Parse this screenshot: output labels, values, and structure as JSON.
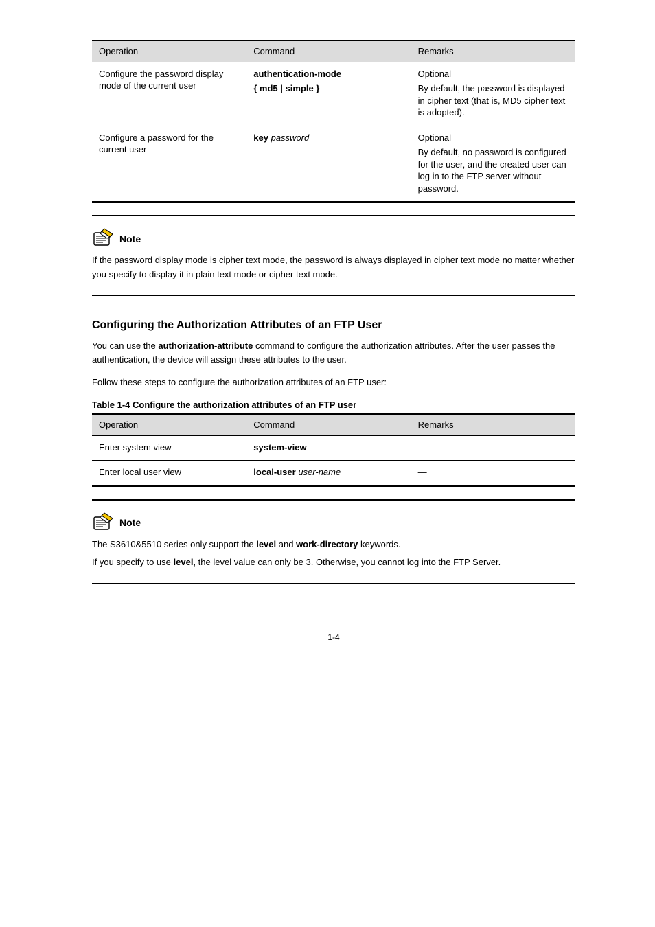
{
  "table1": {
    "headers": [
      "Operation",
      "Command",
      "Remarks"
    ],
    "rows": [
      {
        "op": "Configure the password display mode of the current user",
        "cmd_main": "authentication-mode",
        "cmd_opt": "{ md5 | simple }",
        "rem_title": "Optional",
        "rem_body": "By default, the password is displayed in cipher text (that is, MD5 cipher text is adopted)."
      },
      {
        "op": "Configure a password for the current user",
        "cmd_main": "key",
        "cmd_arg": "password",
        "rem_title": "Optional",
        "rem_body": "By default, no password is configured for the user, and the created user can log in to the FTP server without password."
      }
    ]
  },
  "note1": {
    "label": "Note",
    "body": "If the password display mode is cipher text mode, the password is always displayed in cipher text mode no matter whether you specify to display it in plain text mode or cipher text mode."
  },
  "section_heading": "Configuring the Authorization Attributes of an FTP User",
  "para1": {
    "pre": "You can use the ",
    "cmd": "authorization-attribute",
    "post": " command to configure the authorization attributes. After the user passes the authentication, the device will assign these attributes to the user."
  },
  "para2": "Follow these steps to configure the authorization attributes of an FTP user:",
  "table2_caption": "Table 1-4 Configure the authorization attributes of an FTP user",
  "table2": {
    "headers": [
      "Operation",
      "Command",
      "Remarks"
    ],
    "rows": [
      {
        "op": "Enter system view",
        "cmd": "system-view",
        "rem": "—"
      },
      {
        "op": "Enter local user view",
        "cmd_main": "local-user",
        "cmd_arg": "user-name",
        "rem": "—"
      }
    ]
  },
  "note2": {
    "label": "Note",
    "lines": [
      {
        "pre": "The S3610&5510 series only support the ",
        "b1": "level",
        "mid": " and ",
        "b2": "work-directory",
        "post": " keywords."
      },
      {
        "pre": "If you specify to use ",
        "b1": "level",
        "post": ", the level value can only be 3. Otherwise, you cannot log into the FTP Server."
      }
    ]
  },
  "page_number": "1-4"
}
